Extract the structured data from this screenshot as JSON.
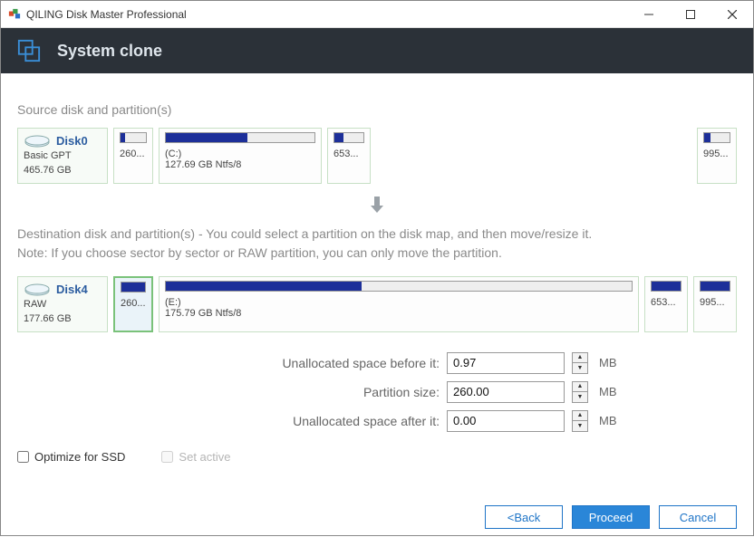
{
  "window": {
    "title": "QILING Disk Master Professional",
    "header": "System clone"
  },
  "source": {
    "label": "Source disk and partition(s)",
    "disk": {
      "name": "Disk0",
      "type": "Basic GPT",
      "size": "465.76 GB"
    },
    "parts": [
      {
        "size": "260...",
        "label": "",
        "fill": 18
      },
      {
        "size": "127.69 GB Ntfs/8",
        "label": "(C:)",
        "fill": 55
      },
      {
        "size": "653...",
        "label": "",
        "fill": 30
      },
      {
        "size": "995...",
        "label": "",
        "fill": 25
      }
    ]
  },
  "dest": {
    "text_line1": "Destination disk and partition(s) - You could select a partition on the disk map, and then move/resize it.",
    "text_line2": "Note: If you choose sector by sector or RAW partition, you can only move the partition.",
    "disk": {
      "name": "Disk4",
      "type": "RAW",
      "size": "177.66 GB"
    },
    "parts": [
      {
        "size": "260...",
        "label": "",
        "fill": 100,
        "selected": true
      },
      {
        "size": "175.79 GB Ntfs/8",
        "label": "(E:)",
        "fill": 42
      },
      {
        "size": "653...",
        "label": "",
        "fill": 100
      },
      {
        "size": "995...",
        "label": "",
        "fill": 100
      }
    ]
  },
  "form": {
    "before_label": "Unallocated space before it:",
    "before_value": "0.97",
    "partsize_label": "Partition size:",
    "partsize_value": "260.00",
    "after_label": "Unallocated space after it:",
    "after_value": "0.00",
    "unit": "MB"
  },
  "checks": {
    "optimize_ssd": "Optimize for SSD",
    "set_active": "Set active"
  },
  "buttons": {
    "back": "<Back",
    "proceed": "Proceed",
    "cancel": "Cancel"
  }
}
